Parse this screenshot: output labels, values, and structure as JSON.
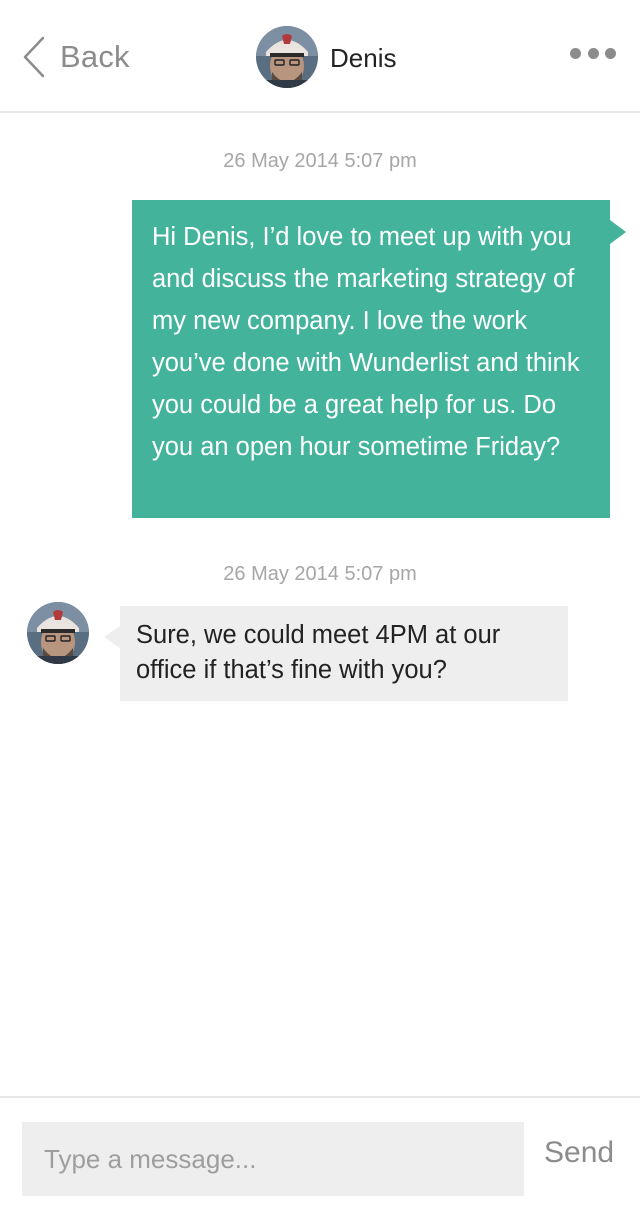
{
  "header": {
    "back_label": "Back",
    "contact_name": "Denis",
    "more_icon": "more-horizontal-icon"
  },
  "conversation": {
    "messages": [
      {
        "timestamp": "26 May 2014 5:07 pm",
        "direction": "outgoing",
        "text": "Hi Denis, I’d love to meet up with you and discuss the marketing strategy of my new company. I love the work you’ve done with Wunderlist and think you could be a great help for us. Do you an open hour sometime Friday?"
      },
      {
        "timestamp": "26 May 2014 5:07 pm",
        "direction": "incoming",
        "text": "Sure, we could meet 4PM at our office if that’s fine with you?"
      }
    ]
  },
  "composer": {
    "placeholder": "Type a message...",
    "value": "",
    "send_label": "Send"
  },
  "colors": {
    "outgoing_bubble": "#44b39b",
    "incoming_bubble": "#eeeeee",
    "muted_text": "#8c8c8c",
    "timestamp_text": "#a6a6a6"
  }
}
